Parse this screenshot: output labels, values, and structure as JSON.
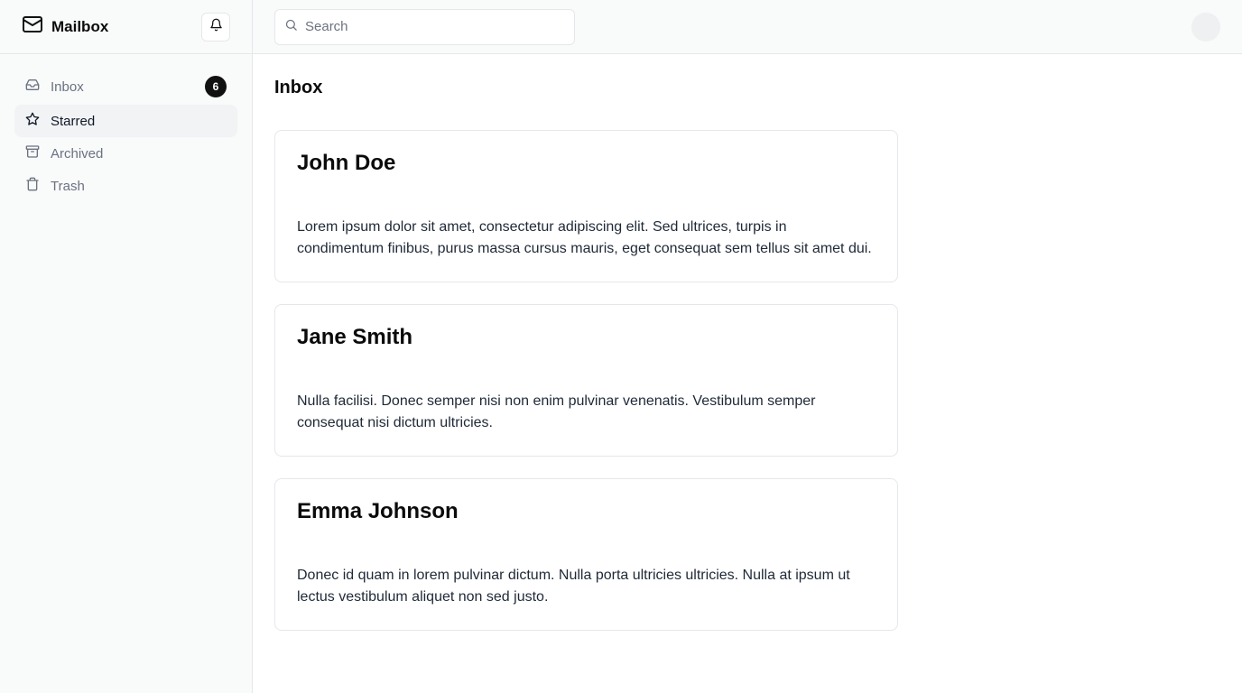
{
  "app": {
    "name": "Mailbox"
  },
  "sidebar": {
    "items": [
      {
        "label": "Inbox",
        "icon": "inbox-icon",
        "badge": "6",
        "active": false
      },
      {
        "label": "Starred",
        "icon": "star-icon",
        "active": true
      },
      {
        "label": "Archived",
        "icon": "archive-icon",
        "active": false
      },
      {
        "label": "Trash",
        "icon": "trash-icon",
        "active": false
      }
    ]
  },
  "search": {
    "placeholder": "Search",
    "value": ""
  },
  "main": {
    "title": "Inbox",
    "messages": [
      {
        "sender": "John Doe",
        "body": "Lorem ipsum dolor sit amet, consectetur adipiscing elit. Sed ultrices, turpis in condimentum finibus, purus massa cursus mauris, eget consequat sem tellus sit amet dui."
      },
      {
        "sender": "Jane Smith",
        "body": "Nulla facilisi. Donec semper nisi non enim pulvinar venenatis. Vestibulum semper consequat nisi dictum ultricies."
      },
      {
        "sender": "Emma Johnson",
        "body": "Donec id quam in lorem pulvinar dictum. Nulla porta ultricies ultricies. Nulla at ipsum ut lectus vestibulum aliquet non sed justo."
      }
    ]
  },
  "colors": {
    "accent": "#111111",
    "sidebar_bg": "#f9fafa",
    "active_item_bg": "#f1f3f5",
    "muted_text": "#6b7280",
    "border": "#e5e7eb"
  }
}
